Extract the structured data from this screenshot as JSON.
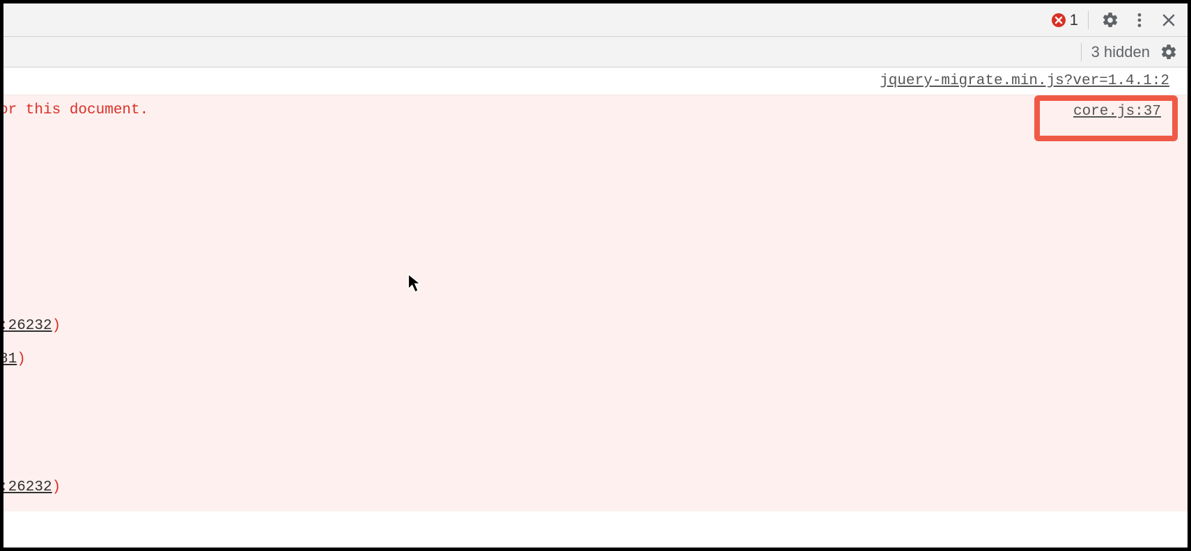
{
  "toolbar": {
    "error_count": "1",
    "hidden_text": "3 hidden"
  },
  "console": {
    "prev_source": "jquery-migrate.min.js?ver=1.4.1:2",
    "error_source": "core.js:37",
    "error_fragment": "or this document.",
    "stack1_tail": ":26232",
    "stack1_paren": ")",
    "stack2_tail": "81",
    "stack2_paren": ")",
    "stack3_tail": ":26232",
    "stack3_paren": ")"
  }
}
